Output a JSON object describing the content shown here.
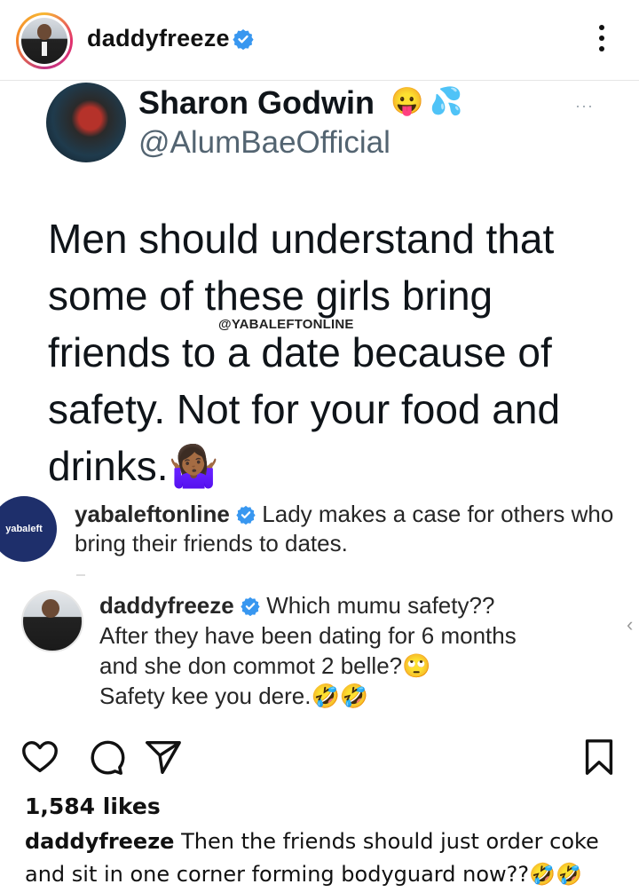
{
  "header": {
    "username": "daddyfreeze"
  },
  "tweet": {
    "display_name": "Sharon Godwin",
    "name_emojis": [
      "😛",
      "💦"
    ],
    "handle": "@AlumBaeOfficial",
    "text": "Men should understand that some of these girls bring friends to a date because of safety. Not for your food and drinks.",
    "text_emoji": "🤷🏾‍♀️",
    "more": "···"
  },
  "watermark": "@YABALEFTONLINE",
  "comments": [
    {
      "username": "yabaleftonline",
      "avatar_text": "yabaleft",
      "text": "Lady makes a case for others who bring their friends to dates."
    },
    {
      "username": "daddyfreeze",
      "line1": "Which mumu safety??",
      "line2": "After they have been dating for 6 months",
      "line3": "and she don commot 2 belle?🙄",
      "line4": "Safety kee you dere.🤣🤣"
    }
  ],
  "post": {
    "likes": "1,584 likes",
    "caption_username": "daddyfreeze",
    "caption_text": "Then the friends should just order coke and sit in one corner forming bodyguard now??🤣🤣"
  },
  "colors": {
    "verified": "#3897f0",
    "handle_gray": "#536471",
    "yabaleft_blue": "#1e2f6b"
  },
  "icons": [
    "heart-icon",
    "comment-icon",
    "share-icon",
    "bookmark-icon",
    "more-icon",
    "verified-icon"
  ]
}
